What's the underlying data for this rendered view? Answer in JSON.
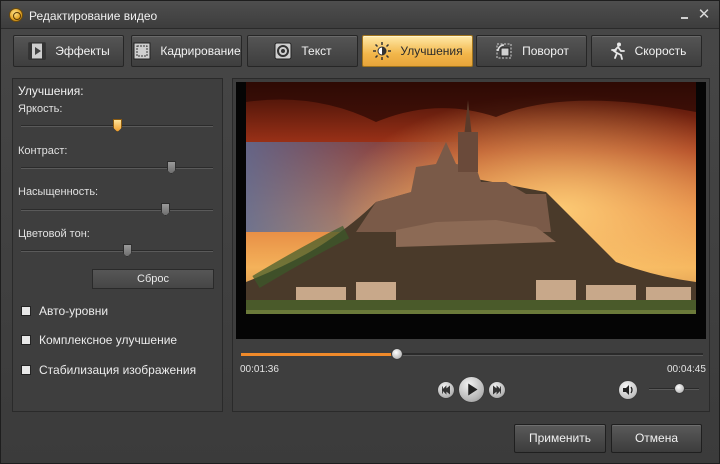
{
  "window": {
    "title": "Редактирование видео",
    "minimize_glyph": "",
    "close_glyph": "✕"
  },
  "tabs": [
    {
      "label": "Эффекты",
      "icon": "effects-icon",
      "active": false
    },
    {
      "label": "Кадрирование",
      "icon": "crop-icon",
      "active": false
    },
    {
      "label": "Текст",
      "icon": "text-icon",
      "active": false
    },
    {
      "label": "Улучшения",
      "icon": "enhance-icon",
      "active": true
    },
    {
      "label": "Поворот",
      "icon": "rotate-icon",
      "active": false
    },
    {
      "label": "Скорость",
      "icon": "speed-icon",
      "active": false
    }
  ],
  "enhancements": {
    "title": "Улучшения:",
    "sliders": [
      {
        "label": "Яркость:",
        "value": 0.5,
        "highlighted": true
      },
      {
        "label": "Контраст:",
        "value": 0.78,
        "highlighted": false
      },
      {
        "label": "Насыщенность:",
        "value": 0.75,
        "highlighted": false
      },
      {
        "label": "Цветовой тон:",
        "value": 0.55,
        "highlighted": false
      }
    ],
    "reset_label": "Сброс",
    "checkboxes": [
      {
        "label": "Авто-уровни",
        "checked": false
      },
      {
        "label": "Комплексное улучшение",
        "checked": false
      },
      {
        "label": "Стабилизация изображения",
        "checked": false
      }
    ]
  },
  "player": {
    "current_time": "00:01:36",
    "total_time": "00:04:45",
    "progress": 0.337,
    "volume": 0.6
  },
  "buttons": {
    "apply_label": "Применить",
    "cancel_label": "Отмена"
  },
  "colors": {
    "accent": "#f08a2a",
    "active_tab": "#f2b64a"
  }
}
